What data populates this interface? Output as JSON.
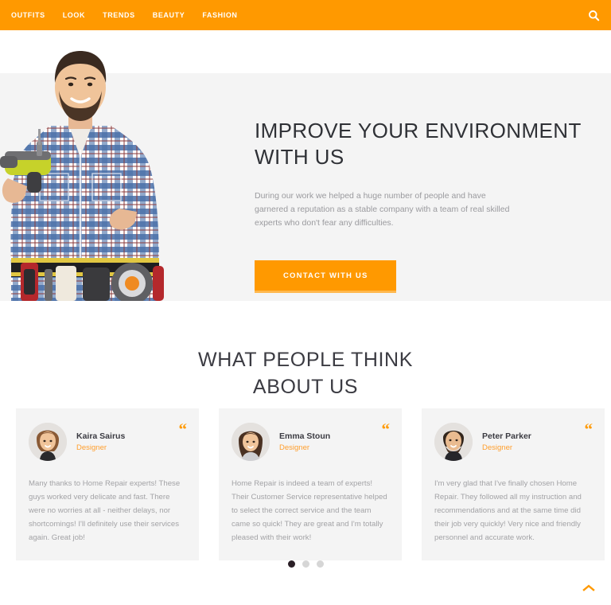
{
  "nav": {
    "items": [
      {
        "label": "OUTFITS"
      },
      {
        "label": "LOOK"
      },
      {
        "label": "TRENDS"
      },
      {
        "label": "BEAUTY"
      },
      {
        "label": "FASHION"
      }
    ],
    "search_icon": "search-icon"
  },
  "hero": {
    "title": "IMPROVE YOUR ENVIRONMENT WITH US",
    "paragraph": "During our work we helped a huge number of people and have garnered a reputation as a stable company with a team of real skilled experts who don't fear any difficulties.",
    "button_label": "CONTACT WITH US",
    "photo_alt": "handyman-with-drill-photo"
  },
  "testimonials": {
    "title_line1": "WHAT PEOPLE THINK",
    "title_line2": "ABOUT US",
    "quote_glyph": "“",
    "cards": [
      {
        "name": "Kaira Sairus",
        "role": "Designer",
        "text": "Many thanks to Home Repair experts! These guys worked very delicate and fast. There were no worries at all - neither delays, nor shortcomings! I'll definitely use their services again. Great job!"
      },
      {
        "name": "Emma Stoun",
        "role": "Designer",
        "text": "Home Repair is indeed a team of experts! Their Customer Service representative helped to select the correct service and the team came so quick! They are great and I'm totally pleased with their work!"
      },
      {
        "name": "Peter Parker",
        "role": "Designer",
        "text": "I'm very glad that I've finally chosen Home Repair. They followed all my instruction and recommendations and at the same time did their job very quickly! Very nice and friendly personnel and accurate work."
      }
    ],
    "pager": {
      "total": 3,
      "active": 1
    }
  },
  "scroll_top": {
    "icon": "chevron-up-icon"
  },
  "colors": {
    "accent": "#ff9900",
    "accent_light": "#ffb84d",
    "band_bg": "#f4f4f4",
    "heading": "#3b3b42",
    "body_text": "#a3a3a6",
    "dot_active": "#2a1f26",
    "dot_inactive": "#d6d6d6"
  }
}
